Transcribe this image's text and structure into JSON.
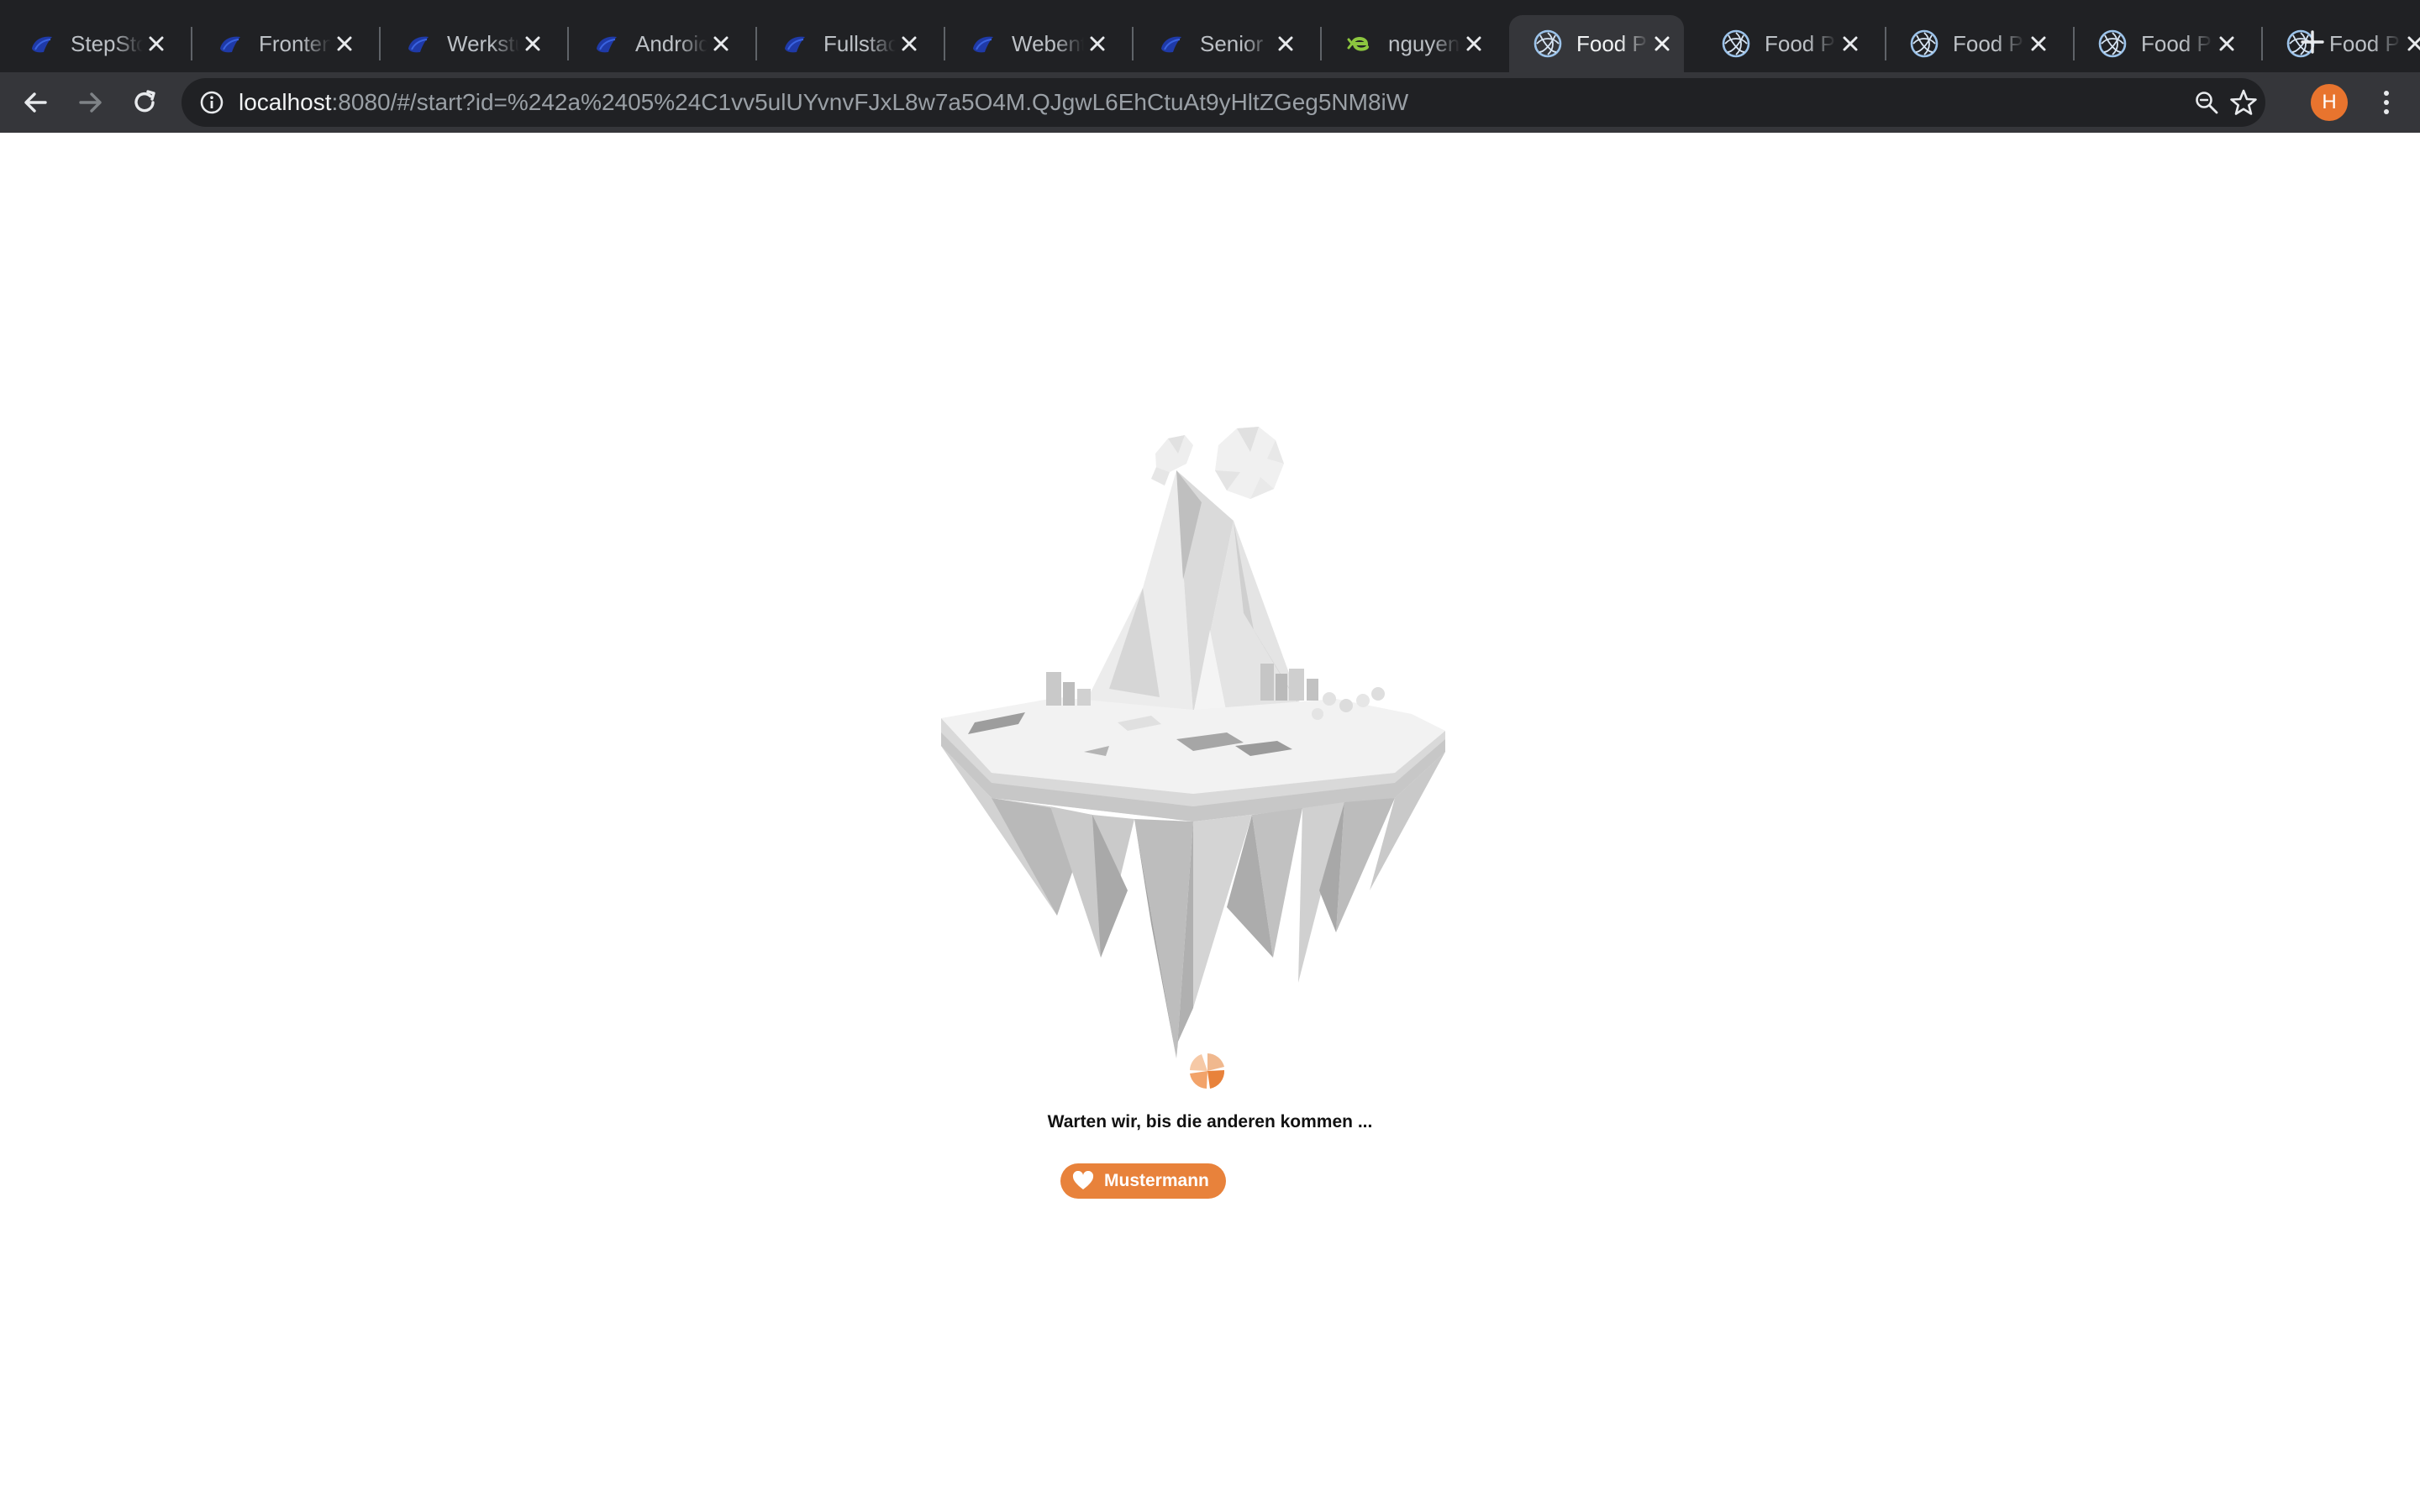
{
  "browser": {
    "tabs": [
      {
        "title": "StepStone",
        "favicon": "stepstone-icon",
        "active": false
      },
      {
        "title": "Frontend",
        "favicon": "stepstone-icon",
        "active": false
      },
      {
        "title": "Werkstudent",
        "favicon": "stepstone-icon",
        "active": false
      },
      {
        "title": "Android",
        "favicon": "stepstone-icon",
        "active": false
      },
      {
        "title": "Fullstack",
        "favicon": "stepstone-icon",
        "active": false
      },
      {
        "title": "Webentwickler",
        "favicon": "stepstone-icon",
        "active": false
      },
      {
        "title": "Senior",
        "favicon": "stepstone-icon",
        "active": false
      },
      {
        "title": "nguyen",
        "favicon": "green-e-icon",
        "active": false
      },
      {
        "title": "Food Planner",
        "favicon": "food-planner-icon",
        "active": true
      },
      {
        "title": "Food Planner",
        "favicon": "food-planner-icon",
        "active": false
      },
      {
        "title": "Food Planner",
        "favicon": "food-planner-icon",
        "active": false
      },
      {
        "title": "Food Planner",
        "favicon": "food-planner-icon",
        "active": false
      },
      {
        "title": "Food Planner",
        "favicon": "food-planner-icon",
        "active": false
      }
    ],
    "url_host": "localhost",
    "url_rest": ":8080/#/start?id=%242a%2405%24C1vv5ulUYvnvFJxL8w7a5O4M.QJgwL6EhCtuAt9yHltZGeg5NM8iW",
    "profile_initial": "H",
    "colors": {
      "frame": "#202124",
      "toolbar": "#35363a",
      "avatar": "#e8742e"
    }
  },
  "page": {
    "waiting_text": "Warten wir, bis die anderen kommen ...",
    "players": [
      {
        "name": "Mustermann",
        "icon": "heart-icon"
      }
    ],
    "colors": {
      "accent": "#e8823b"
    }
  }
}
